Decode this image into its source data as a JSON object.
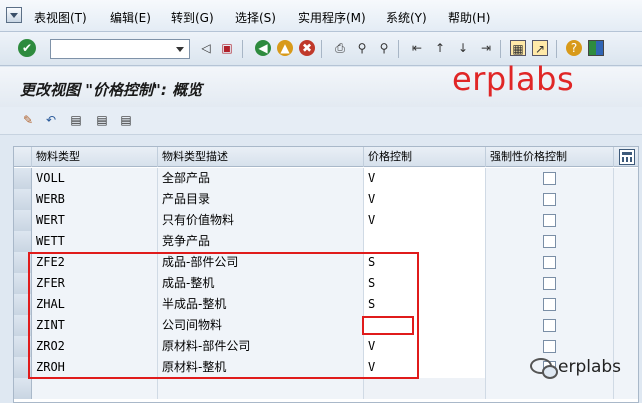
{
  "menu": {
    "items": [
      "表视图(T)",
      "编辑(E)",
      "转到(G)",
      "选择(S)",
      "实用程序(M)",
      "系统(Y)",
      "帮助(H)"
    ]
  },
  "toolbar": {
    "command_value": "",
    "icons": [
      "enter-icon",
      "back-icon",
      "save-icon",
      "back-nav-icon",
      "exit-icon",
      "cancel-icon",
      "print-icon",
      "find-icon",
      "find-next-icon",
      "first-page-icon",
      "previous-page-icon",
      "next-page-icon",
      "last-page-icon",
      "new-session-icon",
      "shortcut-icon",
      "help-icon",
      "layout-icon"
    ]
  },
  "title": "更改视图 \"价格控制\": 概览",
  "watermark": "erplabs",
  "app_toolbar": {
    "icons": [
      "change-display-icon",
      "undo-icon",
      "select-all-icon",
      "select-block-icon",
      "deselect-all-icon"
    ]
  },
  "table": {
    "headers": [
      "物料类型",
      "物料类型描述",
      "价格控制",
      "强制性价格控制"
    ],
    "rows": [
      {
        "type": "VOLL",
        "desc": "全部产品",
        "price": "V",
        "forced": false
      },
      {
        "type": "WERB",
        "desc": "产品目录",
        "price": "V",
        "forced": false
      },
      {
        "type": "WERT",
        "desc": "只有价值物料",
        "price": "V",
        "forced": false
      },
      {
        "type": "WETT",
        "desc": "竞争产品",
        "price": "",
        "forced": false
      },
      {
        "type": "ZFE2",
        "desc": "成品-部件公司",
        "price": "S",
        "forced": false
      },
      {
        "type": "ZFER",
        "desc": "成品-整机",
        "price": "S",
        "forced": false
      },
      {
        "type": "ZHAL",
        "desc": "半成品-整机",
        "price": "S",
        "forced": false
      },
      {
        "type": "ZINT",
        "desc": "公司间物料",
        "price": "",
        "forced": false
      },
      {
        "type": "ZRO2",
        "desc": "原材料-部件公司",
        "price": "V",
        "forced": false
      },
      {
        "type": "ZROH",
        "desc": "原材料-整机",
        "price": "V",
        "forced": false
      },
      {
        "type": "",
        "desc": "",
        "price": "",
        "forced": false
      }
    ]
  },
  "badge": {
    "text": "erplabs"
  },
  "colors": {
    "annotation_red": "#e01b1b",
    "watermark_red": "#e02626"
  }
}
